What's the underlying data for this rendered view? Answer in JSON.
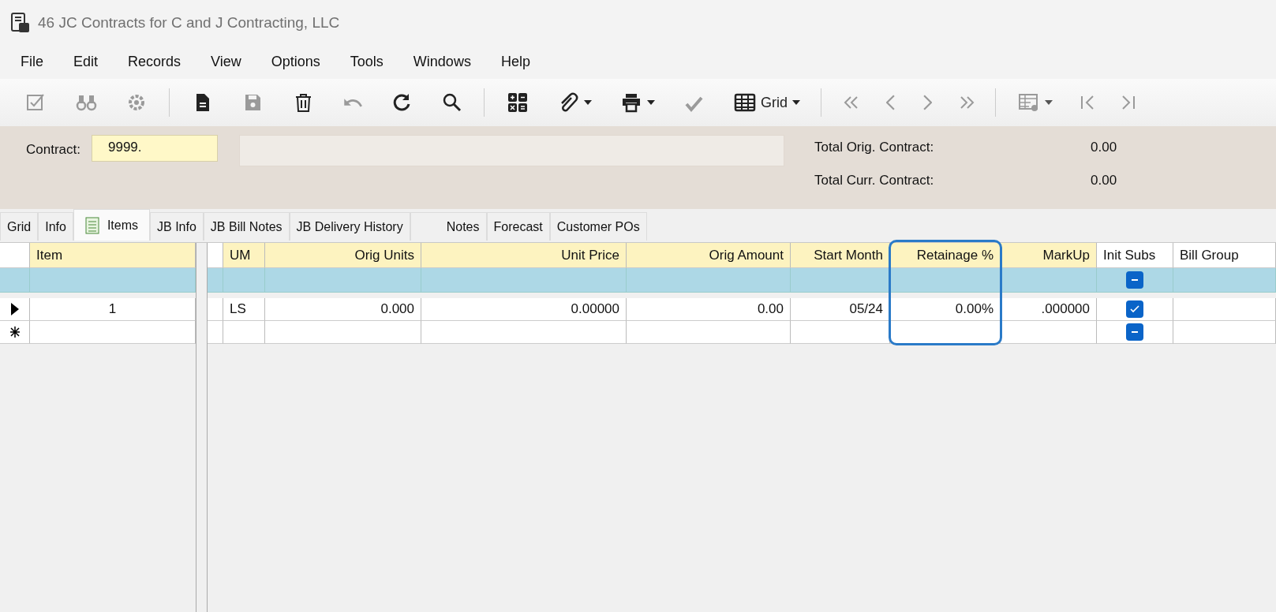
{
  "window": {
    "title": "46 JC Contracts for C and J Contracting, LLC"
  },
  "menu": [
    "File",
    "Edit",
    "Records",
    "View",
    "Options",
    "Tools",
    "Windows",
    "Help"
  ],
  "toolbar": [
    {
      "kind": "button",
      "disabled": true
    },
    {
      "kind": "button",
      "disabled": true
    },
    {
      "kind": "button",
      "disabled": true
    },
    {
      "kind": "separator"
    },
    {
      "kind": "button",
      "disabled": false
    },
    {
      "kind": "button",
      "disabled": true
    },
    {
      "kind": "button",
      "disabled": false
    },
    {
      "kind": "button",
      "disabled": true
    },
    {
      "kind": "button",
      "disabled": false
    },
    {
      "kind": "button",
      "disabled": false
    },
    {
      "kind": "separator"
    },
    {
      "kind": "button",
      "disabled": false
    },
    {
      "kind": "dropdown",
      "disabled": false
    },
    {
      "kind": "dropdown",
      "disabled": false
    },
    {
      "kind": "button",
      "disabled": true
    },
    {
      "kind": "dropdown",
      "disabled": false,
      "label": "Grid"
    },
    {
      "kind": "separator"
    },
    {
      "kind": "button",
      "disabled": true
    },
    {
      "kind": "button",
      "disabled": true
    },
    {
      "kind": "button",
      "disabled": true
    },
    {
      "kind": "button",
      "disabled": true
    },
    {
      "kind": "separator"
    },
    {
      "kind": "dropdown",
      "disabled": true
    },
    {
      "kind": "button",
      "disabled": true
    },
    {
      "kind": "button",
      "disabled": true
    }
  ],
  "header": {
    "contract_label": "Contract:",
    "contract_value": "9999.",
    "totals": [
      {
        "label": "Total Orig. Contract:",
        "value": "0.00"
      },
      {
        "label": "Total Curr. Contract:",
        "value": "0.00"
      }
    ]
  },
  "tabs": [
    {
      "label": "Grid",
      "selected": false
    },
    {
      "label": "Info",
      "selected": false
    },
    {
      "label": "Items",
      "selected": true
    },
    {
      "label": "JB Info",
      "selected": false
    },
    {
      "label": "JB Bill Notes",
      "selected": false
    },
    {
      "label": "JB Delivery History",
      "selected": false
    },
    {
      "label": "Notes",
      "selected": false
    },
    {
      "label": "Forecast",
      "selected": false
    },
    {
      "label": "Customer POs",
      "selected": false
    }
  ],
  "grid": {
    "columns": [
      {
        "label": "Item",
        "shaded": true,
        "highlighted": false
      },
      {
        "label": "UM",
        "shaded": true,
        "highlighted": false
      },
      {
        "label": "Orig Units",
        "shaded": true,
        "highlighted": false
      },
      {
        "label": "Unit Price",
        "shaded": true,
        "highlighted": false
      },
      {
        "label": "Orig Amount",
        "shaded": true,
        "highlighted": false
      },
      {
        "label": "Start Month",
        "shaded": true,
        "highlighted": false
      },
      {
        "label": "Retainage %",
        "shaded": true,
        "highlighted": true
      },
      {
        "label": "MarkUp",
        "shaded": true,
        "highlighted": false
      },
      {
        "label": "Init Subs",
        "shaded": false,
        "highlighted": false
      },
      {
        "label": "Bill Group",
        "shaded": false,
        "highlighted": false
      }
    ],
    "rows": [
      {
        "kind": "filter",
        "current": false,
        "new": false,
        "cells": [
          null,
          null,
          null,
          null,
          null,
          null,
          null,
          null,
          {
            "checked": false,
            "indeterminate": true
          },
          null
        ]
      },
      {
        "kind": "record",
        "current": true,
        "new": false,
        "cells": [
          "1",
          "LS",
          "0.000",
          "0.00000",
          "0.00",
          "05/24",
          "0.00%",
          ".000000",
          {
            "checked": true,
            "indeterminate": false
          },
          null
        ]
      },
      {
        "kind": "record",
        "current": false,
        "new": true,
        "cells": [
          null,
          null,
          null,
          null,
          null,
          null,
          null,
          null,
          {
            "checked": false,
            "indeterminate": true
          },
          null
        ]
      }
    ]
  }
}
